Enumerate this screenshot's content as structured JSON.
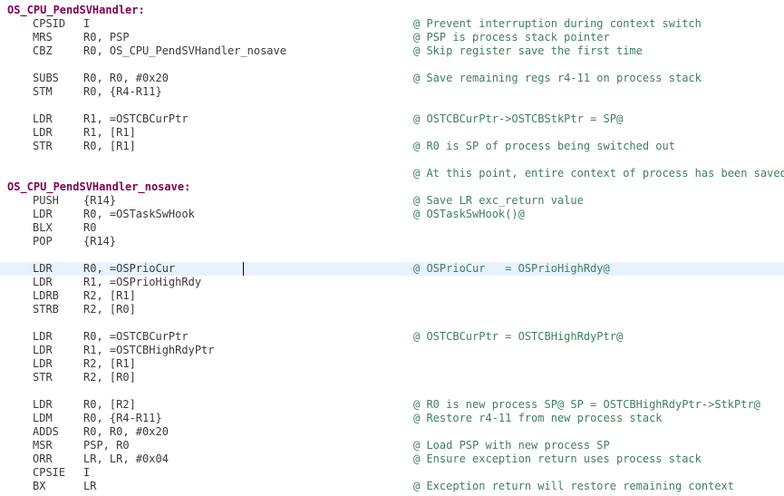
{
  "editor": {
    "lines": [
      {
        "label": "OS_CPU_PendSVHandler:",
        "op": "",
        "args": "",
        "comment": ""
      },
      {
        "label": "",
        "op": "CPSID",
        "args": "I",
        "comment": "@ Prevent interruption during context switch"
      },
      {
        "label": "",
        "op": "MRS",
        "args": "R0, PSP",
        "comment": "@ PSP is process stack pointer"
      },
      {
        "label": "",
        "op": "CBZ",
        "args": "R0, OS_CPU_PendSVHandler_nosave",
        "comment": "@ Skip register save the first time"
      },
      {
        "label": "",
        "op": "",
        "args": "",
        "comment": ""
      },
      {
        "label": "",
        "op": "SUBS",
        "args": "R0, R0, #0x20",
        "comment": "@ Save remaining regs r4-11 on process stack"
      },
      {
        "label": "",
        "op": "STM",
        "args": "R0, {R4-R11}",
        "comment": ""
      },
      {
        "label": "",
        "op": "",
        "args": "",
        "comment": ""
      },
      {
        "label": "",
        "op": "LDR",
        "args": "R1, =OSTCBCurPtr",
        "comment": "@ OSTCBCurPtr->OSTCBStkPtr = SP@"
      },
      {
        "label": "",
        "op": "LDR",
        "args": "R1, [R1]",
        "comment": ""
      },
      {
        "label": "",
        "op": "STR",
        "args": "R0, [R1]",
        "comment": "@ R0 is SP of process being switched out"
      },
      {
        "label": "",
        "op": "",
        "args": "",
        "comment": ""
      },
      {
        "label": "",
        "op": "",
        "args": "",
        "comment": "@ At this point, entire context of process has been saved"
      },
      {
        "label": "OS_CPU_PendSVHandler_nosave:",
        "op": "",
        "args": "",
        "comment": ""
      },
      {
        "label": "",
        "op": "PUSH",
        "args": "{R14}",
        "comment": "@ Save LR exc_return value"
      },
      {
        "label": "",
        "op": "LDR",
        "args": "R0, =OSTaskSwHook",
        "comment": "@ OSTaskSwHook()@"
      },
      {
        "label": "",
        "op": "BLX",
        "args": "R0",
        "comment": ""
      },
      {
        "label": "",
        "op": "POP",
        "args": "{R14}",
        "comment": ""
      },
      {
        "label": "",
        "op": "",
        "args": "",
        "comment": ""
      },
      {
        "label": "",
        "op": "LDR",
        "args": "R0, =OSPrioCur",
        "comment": "@ OSPrioCur   = OSPrioHighRdy@"
      },
      {
        "label": "",
        "op": "LDR",
        "args": "R1, =OSPrioHighRdy",
        "comment": ""
      },
      {
        "label": "",
        "op": "LDRB",
        "args": "R2, [R1]",
        "comment": ""
      },
      {
        "label": "",
        "op": "STRB",
        "args": "R2, [R0]",
        "comment": ""
      },
      {
        "label": "",
        "op": "",
        "args": "",
        "comment": ""
      },
      {
        "label": "",
        "op": "LDR",
        "args": "R0, =OSTCBCurPtr",
        "comment": "@ OSTCBCurPtr = OSTCBHighRdyPtr@"
      },
      {
        "label": "",
        "op": "LDR",
        "args": "R1, =OSTCBHighRdyPtr",
        "comment": ""
      },
      {
        "label": "",
        "op": "LDR",
        "args": "R2, [R1]",
        "comment": ""
      },
      {
        "label": "",
        "op": "STR",
        "args": "R2, [R0]",
        "comment": ""
      },
      {
        "label": "",
        "op": "",
        "args": "",
        "comment": ""
      },
      {
        "label": "",
        "op": "LDR",
        "args": "R0, [R2]",
        "comment": "@ R0 is new process SP@ SP = OSTCBHighRdyPtr->StkPtr@"
      },
      {
        "label": "",
        "op": "LDM",
        "args": "R0, {R4-R11}",
        "comment": "@ Restore r4-11 from new process stack"
      },
      {
        "label": "",
        "op": "ADDS",
        "args": "R0, R0, #0x20",
        "comment": ""
      },
      {
        "label": "",
        "op": "MSR",
        "args": "PSP, R0",
        "comment": "@ Load PSP with new process SP"
      },
      {
        "label": "",
        "op": "ORR",
        "args": "LR, LR, #0x04",
        "comment": "@ Ensure exception return uses process stack"
      },
      {
        "label": "",
        "op": "CPSIE",
        "args": "I",
        "comment": ""
      },
      {
        "label": "",
        "op": "BX",
        "args": "LR",
        "comment": "@ Exception return will restore remaining context"
      }
    ],
    "current_line": 19
  }
}
